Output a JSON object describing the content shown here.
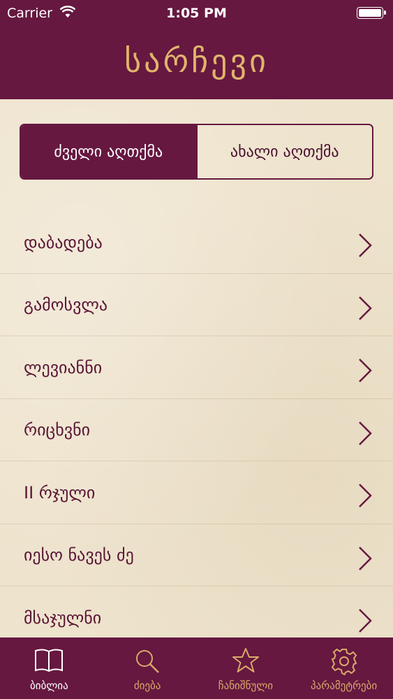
{
  "status_bar": {
    "carrier": "Carrier",
    "time": "1:05 PM"
  },
  "nav": {
    "title": "სარჩევი"
  },
  "segments": [
    {
      "label": "ძველი აღთქმა",
      "selected": true
    },
    {
      "label": "ახალი აღთქმა",
      "selected": false
    }
  ],
  "books": [
    "დაბადება",
    "გამოსვლა",
    "ლევიანნი",
    "რიცხვნი",
    "II რჯული",
    "იესო ნავეს ძე",
    "მსაჯულნი"
  ],
  "tabbar": [
    {
      "label": "ბიბლია",
      "icon": "book-icon",
      "active": true
    },
    {
      "label": "ძიება",
      "icon": "search-icon",
      "active": false
    },
    {
      "label": "ჩანიშნული",
      "icon": "star-icon",
      "active": false
    },
    {
      "label": "პარამეტრები",
      "icon": "gear-icon",
      "active": false
    }
  ],
  "colors": {
    "primary": "#661840",
    "accent": "#e0b46c",
    "background": "#eee3cd"
  }
}
